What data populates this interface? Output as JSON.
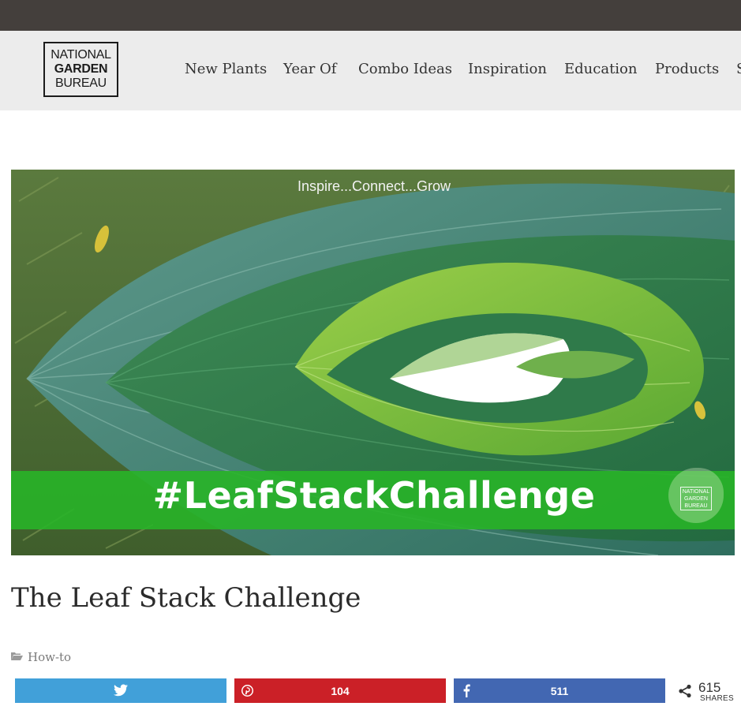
{
  "header": {
    "logo": {
      "line1": "NATIONAL",
      "line2": "GARDEN",
      "line3": "BUREAU"
    },
    "nav": [
      {
        "label": "New Plants"
      },
      {
        "label": "Year Of"
      },
      {
        "label": "Combo Ideas"
      },
      {
        "label": "Inspiration"
      },
      {
        "label": "Education"
      },
      {
        "label": "Products"
      },
      {
        "label": "S"
      }
    ]
  },
  "hero": {
    "tagline": "Inspire...Connect...Grow",
    "hashtag": "#LeafStackChallenge",
    "badge": {
      "line1": "NATIONAL",
      "line2": "GARDEN",
      "line3": "BUREAU"
    }
  },
  "article": {
    "title": "The Leaf Stack Challenge",
    "category": "How-to"
  },
  "share": {
    "twitter": {
      "count": "",
      "color": "#41a0d9"
    },
    "pinterest": {
      "count": "104",
      "color": "#cb2027"
    },
    "facebook": {
      "count": "511",
      "color": "#4267b2"
    },
    "total": {
      "count": "615",
      "label": "SHARES"
    }
  },
  "colors": {
    "topbar": "#443f3c",
    "header_bg": "#ececec",
    "banner_green": "#2db32d"
  }
}
